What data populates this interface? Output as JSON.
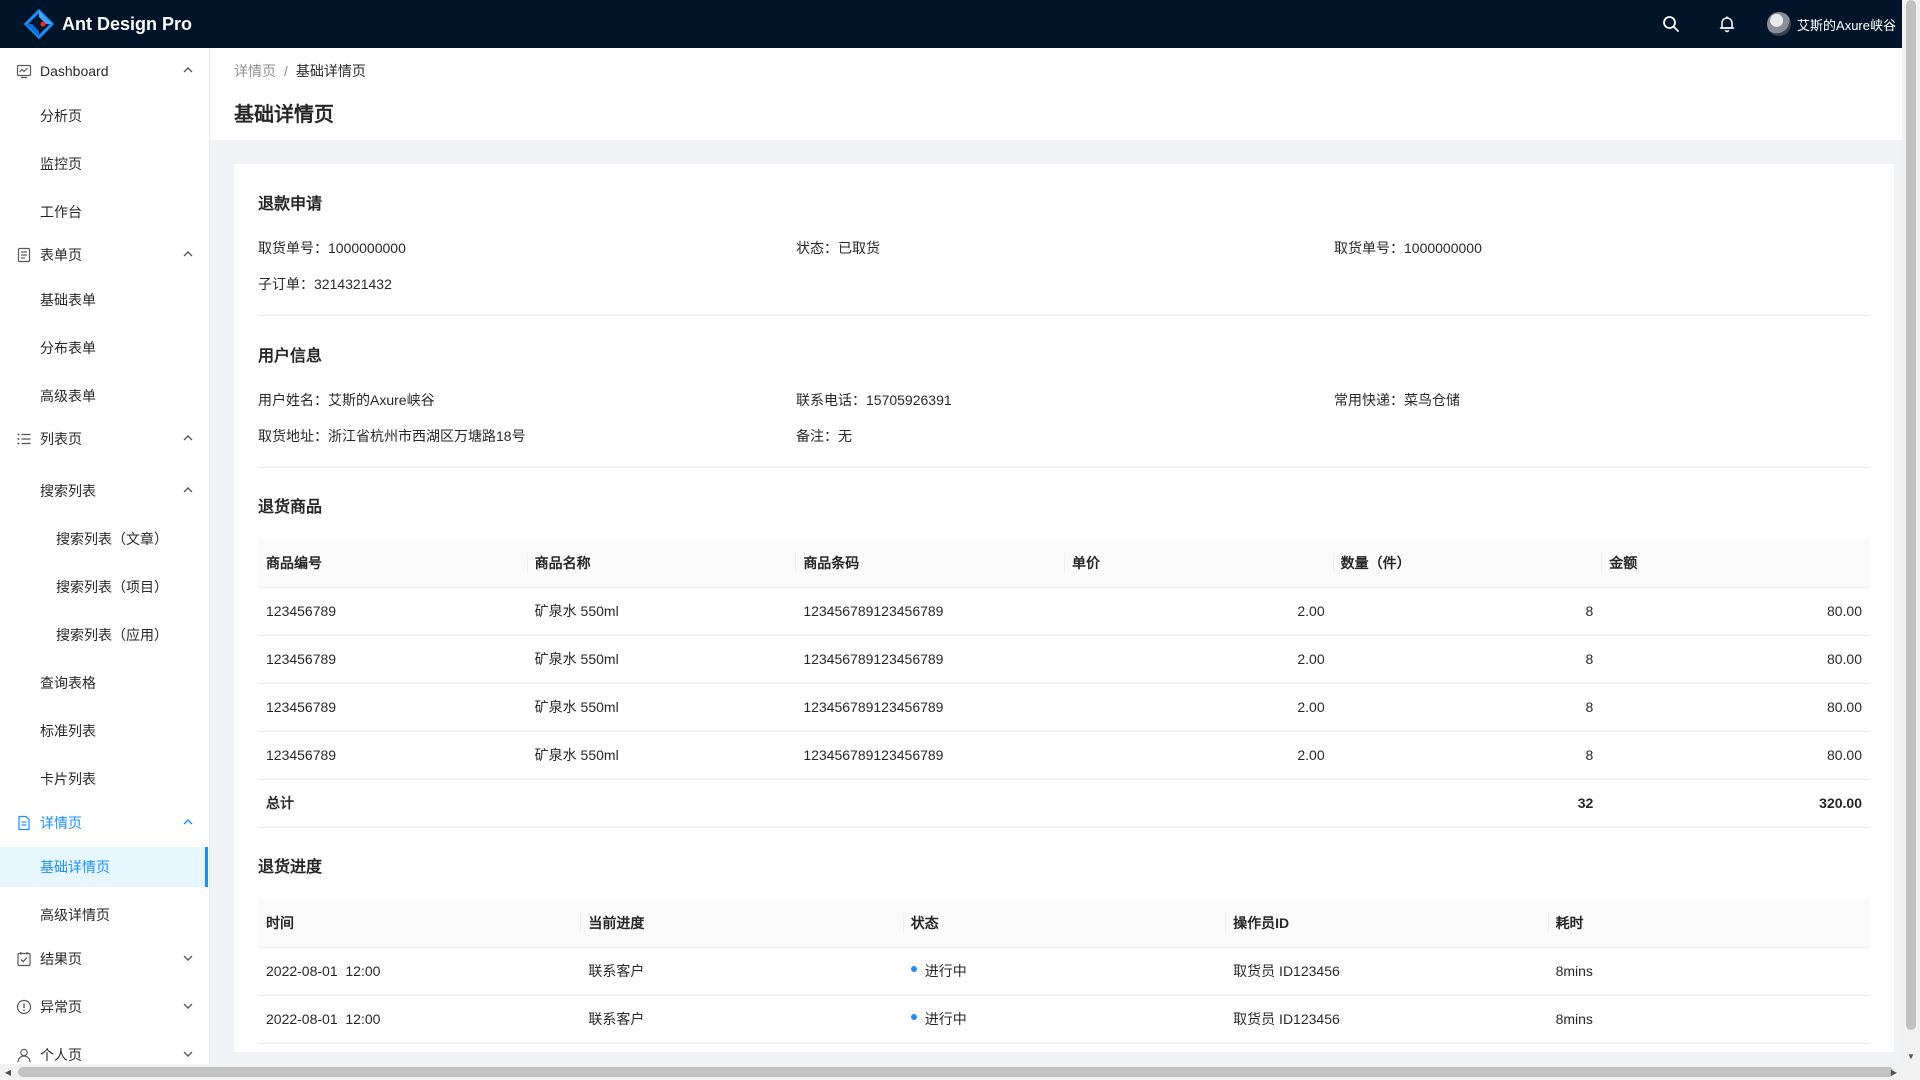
{
  "header": {
    "app_title": "Ant Design Pro",
    "user_name": "艾斯的Axure峡谷",
    "icons": [
      "search-icon",
      "bell-icon"
    ]
  },
  "sidebar": {
    "dashboard": {
      "label": "Dashboard",
      "items": [
        "分析页",
        "监控页",
        "工作台"
      ]
    },
    "form": {
      "label": "表单页",
      "items": [
        "基础表单",
        "分布表单",
        "高级表单"
      ]
    },
    "list": {
      "label": "列表页",
      "search": {
        "label": "搜索列表",
        "items": [
          "搜索列表（文章）",
          "搜索列表（项目）",
          "搜索列表（应用）"
        ]
      },
      "items": [
        "查询表格",
        "标准列表",
        "卡片列表"
      ]
    },
    "detail": {
      "label": "详情页",
      "items": [
        "基础详情页",
        "高级详情页"
      ]
    },
    "result": {
      "label": "结果页"
    },
    "exception": {
      "label": "异常页"
    },
    "account": {
      "label": "个人页"
    }
  },
  "breadcrumb": {
    "parent": "详情页",
    "separator": "/",
    "current": "基础详情页"
  },
  "page_title": "基础详情页",
  "refund": {
    "title": "退款申请",
    "pickup_no": {
      "key": "取货单号：",
      "value": "1000000000"
    },
    "status": {
      "key": "状态：",
      "value": "已取货"
    },
    "pickup_no2": {
      "key": "取货单号：",
      "value": "1000000000"
    },
    "sub_order": {
      "key": "子订单：",
      "value": "3214321432"
    }
  },
  "user_info": {
    "title": "用户信息",
    "name": {
      "key": "用户姓名：",
      "value": "艾斯的Axure峡谷"
    },
    "phone": {
      "key": "联系电话：",
      "value": "15705926391"
    },
    "courier": {
      "key": "常用快递：",
      "value": "菜鸟仓储"
    },
    "address": {
      "key": "取货地址：",
      "value": "浙江省杭州市西湖区万塘路18号"
    },
    "remark": {
      "key": "备注：",
      "value": "无"
    }
  },
  "goods": {
    "title": "退货商品",
    "columns": [
      "商品编号",
      "商品名称",
      "商品条码",
      "单价",
      "数量（件）",
      "金额"
    ],
    "rows": [
      [
        "123456789",
        "矿泉水 550ml",
        "123456789123456789",
        "2.00",
        "8",
        "80.00"
      ],
      [
        "123456789",
        "矿泉水 550ml",
        "123456789123456789",
        "2.00",
        "8",
        "80.00"
      ],
      [
        "123456789",
        "矿泉水 550ml",
        "123456789123456789",
        "2.00",
        "8",
        "80.00"
      ],
      [
        "123456789",
        "矿泉水 550ml",
        "123456789123456789",
        "2.00",
        "8",
        "80.00"
      ]
    ],
    "total_label": "总计",
    "total_qty": "32",
    "total_amount": "320.00"
  },
  "progress": {
    "title": "退货进度",
    "columns": [
      "时间",
      "当前进度",
      "状态",
      "操作员ID",
      "耗时"
    ],
    "rows": [
      [
        "2022-08-01  12:00",
        "联系客户",
        "进行中",
        "取货员 ID123456",
        "8mins"
      ],
      [
        "2022-08-01  12:00",
        "联系客户",
        "进行中",
        "取货员 ID123456",
        "8mins"
      ]
    ],
    "status_color": "#1890ff"
  },
  "colors": {
    "primary": "#1890ff",
    "header_bg": "#001529",
    "page_bg": "#f0f2f5"
  }
}
